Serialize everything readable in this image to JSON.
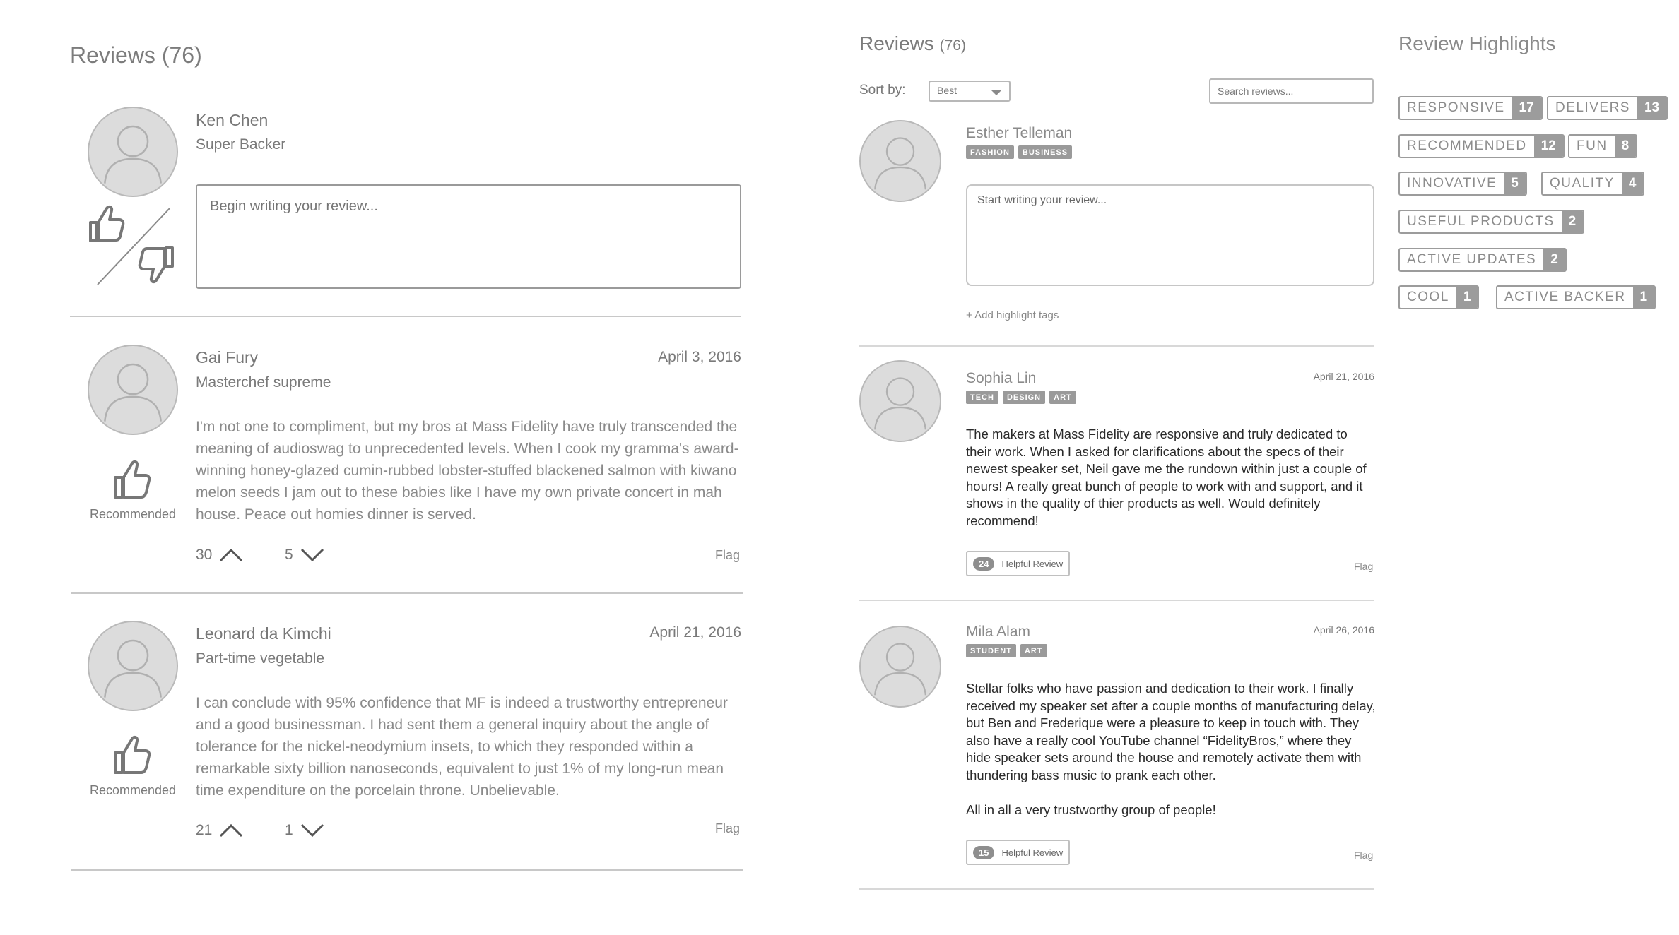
{
  "left": {
    "title": "Reviews (76)",
    "composer": {
      "name": "Ken Chen",
      "subtitle": "Super Backer",
      "placeholder": "Begin writing your review..."
    },
    "reviews": [
      {
        "name": "Gai Fury",
        "subtitle": "Masterchef supreme",
        "date": "April 3, 2016",
        "body": "I'm not one to compliment, but my bros at Mass Fidelity have truly transcended the meaning of audioswag to unprecedented levels. When I cook my gramma's award-winning honey-glazed cumin-rubbed lobster-stuffed blackened salmon with kiwano melon seeds I jam out to these babies like I have my own private concert in mah house. Peace out homies dinner is served.",
        "recommendation": "Recommended",
        "upvotes": "30",
        "downvotes": "5",
        "flag": "Flag"
      },
      {
        "name": "Leonard da Kimchi",
        "subtitle": "Part-time vegetable",
        "date": "April 21, 2016",
        "body": "I can conclude with 95% confidence that MF is indeed a trustworthy entrepreneur and a good businessman. I had sent them a general inquiry about the angle of tolerance for the nickel-neodymium insets, to which they responded within a remarkable sixty billion nanoseconds, equivalent to just 1% of my long-run mean time expenditure on the porcelain throne. Unbelievable.",
        "recommendation": "Recommended",
        "upvotes": "21",
        "downvotes": "1",
        "flag": "Flag"
      }
    ]
  },
  "right": {
    "title": "Reviews",
    "count": "(76)",
    "sort_label": "Sort by:",
    "sort_value": "Best",
    "search_placeholder": "Search reviews...",
    "composer": {
      "name": "Esther Telleman",
      "tags": [
        "FASHION",
        "BUSINESS"
      ],
      "placeholder": "Start writing your review...",
      "add_tags": "+ Add highlight tags"
    },
    "reviews": [
      {
        "name": "Sophia Lin",
        "tags": [
          "TECH",
          "DESIGN",
          "ART"
        ],
        "date": "April 21, 2016",
        "body": "The makers at Mass Fidelity are responsive and truly dedicated to their work. When I asked for clarifications about the specs of their newest speaker set, Neil gave me the rundown within just a couple of hours! A really great bunch of people to work with and support, and it shows in the quality of thier products as well. Would definitely recommend!",
        "helpful_count": "24",
        "helpful_label": "Helpful Review",
        "flag": "Flag"
      },
      {
        "name": "Mila Alam",
        "tags": [
          "STUDENT",
          "ART"
        ],
        "date": "April 26, 2016",
        "body": "Stellar folks who have passion and dedication to their work. I finally received my speaker set after a couple months of manufacturing delay, but Ben and Frederique were a pleasure to keep in touch with. They also have a really cool YouTube channel “FidelityBros,” where they hide speaker sets around the house and remotely activate them with thundering bass music to prank each other.",
        "body2": "All in all a very trustworthy group of people!",
        "helpful_count": "15",
        "helpful_label": "Helpful Review",
        "flag": "Flag"
      }
    ]
  },
  "highlights": {
    "title": "Review Highlights",
    "items": [
      {
        "label": "RESPONSIVE",
        "count": "17"
      },
      {
        "label": "DELIVERS",
        "count": "13"
      },
      {
        "label": "RECOMMENDED",
        "count": "12"
      },
      {
        "label": "FUN",
        "count": "8"
      },
      {
        "label": "INNOVATIVE",
        "count": "5"
      },
      {
        "label": "QUALITY",
        "count": "4"
      },
      {
        "label": "USEFUL PRODUCTS",
        "count": "2"
      },
      {
        "label": "ACTIVE UPDATES",
        "count": "2"
      },
      {
        "label": "COOL",
        "count": "1"
      },
      {
        "label": "ACTIVE BACKER",
        "count": "1"
      }
    ]
  }
}
